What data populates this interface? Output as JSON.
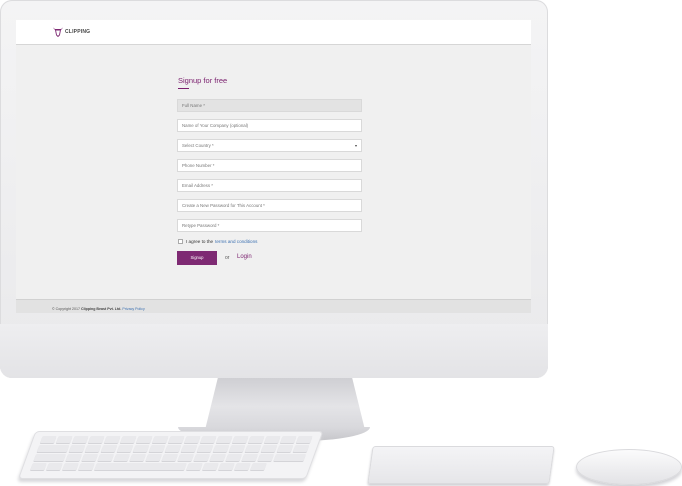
{
  "brand": {
    "logo_text": "CLIPPING"
  },
  "form": {
    "title": "Signup for free",
    "fields": [
      {
        "placeholder": "Full Name *"
      },
      {
        "placeholder": "Name of Your Company (optional)"
      },
      {
        "placeholder": "Select Country *"
      },
      {
        "placeholder": "Phone Number *"
      },
      {
        "placeholder": "Email Address *"
      },
      {
        "placeholder": "Create a New Password for This Account *"
      },
      {
        "placeholder": "Retype Password *"
      }
    ],
    "select_arrow": "▾",
    "agree_prefix": "I agree to the",
    "terms_link": "terms and conditions",
    "signup_label": "Signup",
    "or_text": "or",
    "login_label": "Login"
  },
  "footer": {
    "copyright": "© Copyright 2017",
    "company": "Clipping Beast Pvt. Ltd.",
    "privacy_link": "Privacy Policy"
  },
  "colors": {
    "accent": "#7e2a73",
    "link": "#3a6fb0",
    "screen_bg": "#f0f0f0"
  },
  "icons": {
    "logo": "bull-head-icon",
    "select": "chevron-down-icon"
  }
}
